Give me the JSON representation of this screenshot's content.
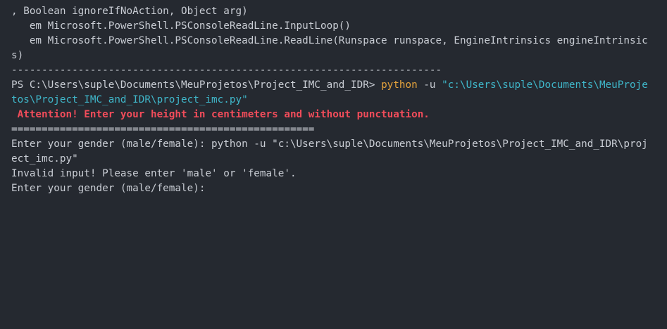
{
  "terminal": {
    "lines": [
      ", Boolean ignoreIfNoAction, Object arg)",
      "   em Microsoft.PowerShell.PSConsoleReadLine.InputLoop()",
      "   em Microsoft.PowerShell.PSConsoleReadLine.ReadLine(Runspace runspace, EngineIntrinsics engineIntrinsic",
      "s)",
      "-----------------------------------------------------------------------"
    ],
    "prompt": {
      "ps_path": "PS C:\\Users\\suple\\Documents\\MeuProjetos\\Project_IMC_and_IDR> ",
      "command": "python",
      "flag": " -u ",
      "script_path_part1": "\"c:\\Users\\suple\\Documents\\MeuProje",
      "script_path_part2": "tos\\Project_IMC_and_IDR\\project_imc.py\""
    },
    "attention": " Attention! Enter your height in centimeters and without punctuation.",
    "separator": "==================================================",
    "gender_line1": "Enter your gender (male/female): python -u \"c:\\Users\\suple\\Documents\\MeuProjetos\\Project_IMC_and_IDR\\proj",
    "gender_line2": "ect_imc.py\"",
    "invalid": "Invalid input! Please enter 'male' or 'female'.",
    "gender_prompt": "Enter your gender (male/female): "
  },
  "colors": {
    "background": "#252930",
    "text": "#c9cdd4",
    "command": "#e5a33d",
    "string": "#3fb6c9",
    "warning": "#f24c5a"
  }
}
